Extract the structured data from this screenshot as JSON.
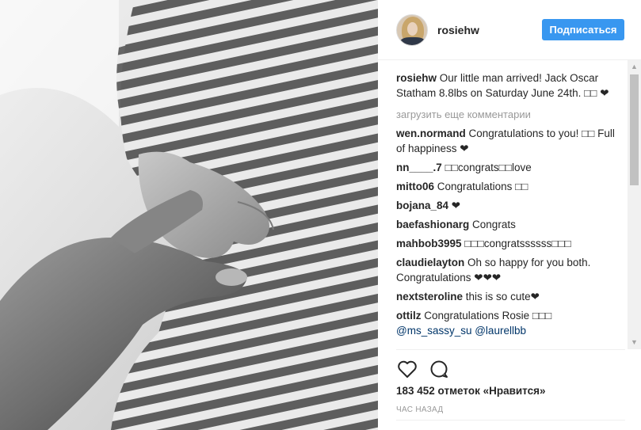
{
  "header": {
    "username": "rosiehw",
    "follow_label": "Подписаться"
  },
  "caption": {
    "author": "rosiehw",
    "text": "Our little man arrived! Jack Oscar Statham 8.8lbs on Saturday June 24th. □□ ❤"
  },
  "load_more_label": "загрузить еще комментарии",
  "comments": [
    {
      "author": "wen.normand",
      "text": "Congratulations to you! □□ Full of happiness ❤"
    },
    {
      "author": "nn____.7",
      "text": "□□congrats□□love"
    },
    {
      "author": "mitto06",
      "text": "Congratulations □□"
    },
    {
      "author": "bojana_84",
      "text": "❤"
    },
    {
      "author": "baefashionarg",
      "text": "Congrats"
    },
    {
      "author": "mahbob3995",
      "text": "□□□congratssssss□□□"
    },
    {
      "author": "claudielayton",
      "text": "Oh so happy for you both. Congratulations ❤❤❤"
    },
    {
      "author": "nextsteroline",
      "text": "this is so cute❤"
    },
    {
      "author": "ottilz",
      "text": "Congratulations Rosie □□□",
      "mentions": "@ms_sassy_su @laurellbb"
    }
  ],
  "likes_label": "183 452 отметок «Нравится»",
  "time_label": "ЧАС НАЗАД",
  "icons": {
    "like": "heart-icon",
    "comment": "comment-bubble-icon"
  },
  "colors": {
    "follow_button": "#3897f0",
    "mention": "#003569",
    "muted": "#999999"
  }
}
